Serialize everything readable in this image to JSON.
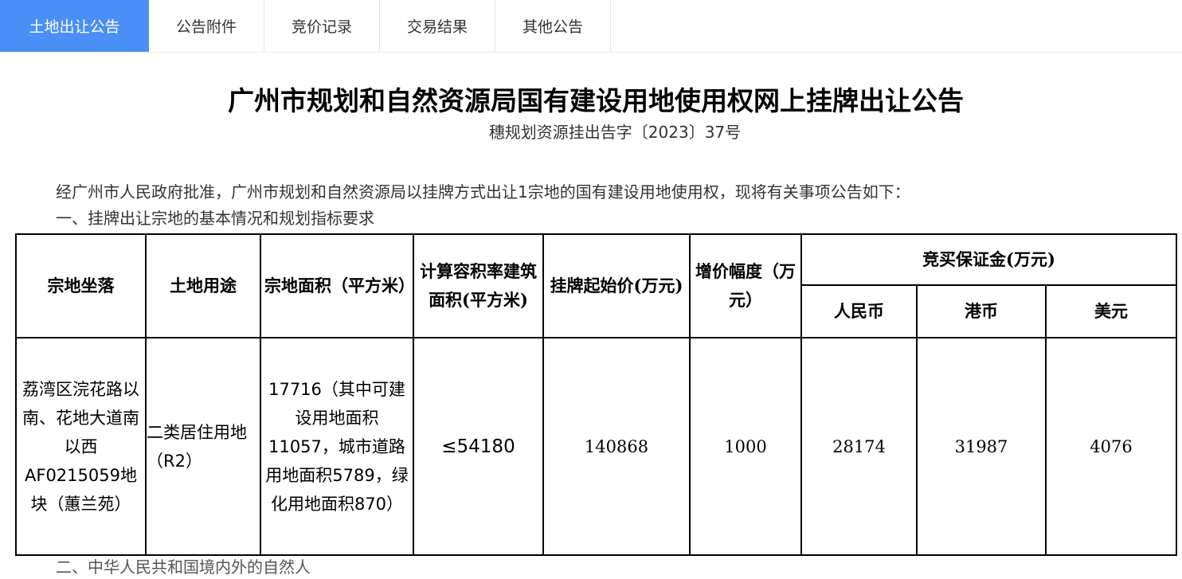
{
  "tabs": [
    {
      "label": "土地出让公告"
    },
    {
      "label": "公告附件"
    },
    {
      "label": "竞价记录"
    },
    {
      "label": "交易结果"
    },
    {
      "label": "其他公告"
    }
  ],
  "colors": {
    "active_tab_bg": "#4a8ff5",
    "active_tab_text": "#ffffff",
    "text": "#333333",
    "table_border": "#000000"
  },
  "document": {
    "title": "广州市规划和自然资源局国有建设用地使用权网上挂牌出让公告",
    "doc_number": "穗规划资源挂出告字〔2023〕37号",
    "intro": "经广州市人民政府批准，广州市规划和自然资源局以挂牌方式出让1宗地的国有建设用地使用权，现将有关事项公告如下：",
    "section1": "一、挂牌出让宗地的基本情况和规划指标要求",
    "section2_partial": "二、中华人民共和国境内外的自然人"
  },
  "table": {
    "headers": {
      "location": "宗地坐落",
      "land_use": "土地用途",
      "area": "宗地面积（平方米）",
      "floor_area": "计算容积率建筑面积(平方米)",
      "start_price": "挂牌起始价(万元)",
      "increment": "增价幅度（万元）",
      "deposit": "竞买保证金(万元)",
      "rmb": "人民币",
      "hkd": "港币",
      "usd": "美元"
    },
    "row": {
      "location": "荔湾区浣花路以南、花地大道南以西AF0215059地块（蕙兰苑）",
      "land_use": "二类居住用地（R2）",
      "area": "17716（其中可建设用地面积11057，城市道路用地面积5789，绿化用地面积870）",
      "floor_area": "≤54180",
      "start_price": "140868",
      "increment": "1000",
      "rmb": "28174",
      "hkd": "31987",
      "usd": "4076"
    }
  }
}
